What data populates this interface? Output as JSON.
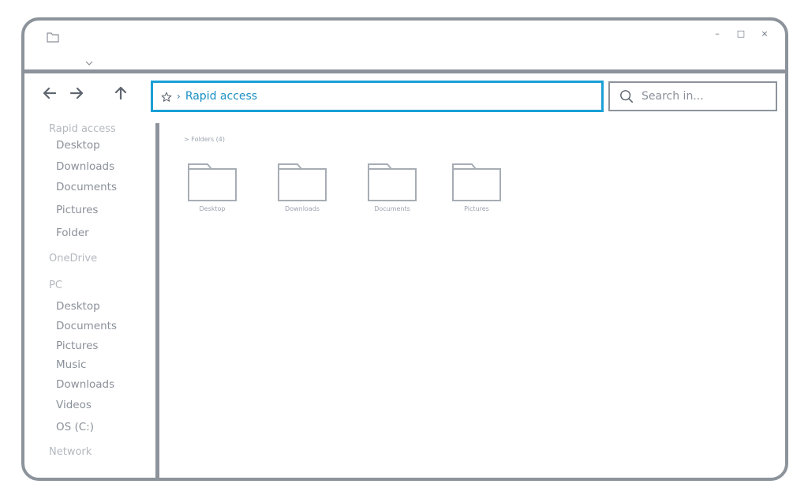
{
  "titlebar": {
    "icon": "folder-icon",
    "chevron_icon": "chevron-down-icon",
    "controls": {
      "minimize": "–",
      "maximize": "□",
      "close": "×"
    }
  },
  "navigation": {
    "back_icon": "arrow-left-icon",
    "forward_icon": "arrow-right-icon",
    "up_icon": "arrow-up-icon"
  },
  "address_bar": {
    "icon": "star-icon",
    "separator": "›",
    "location": "Rapid access"
  },
  "search": {
    "placeholder": "Search in...",
    "icon": "search-icon"
  },
  "sidebar": {
    "sections": [
      {
        "label": "Rapid access",
        "items": [
          "Desktop",
          "Downloads",
          "Documents",
          "Pictures",
          "Folder"
        ]
      },
      {
        "label": "OneDrive",
        "items": []
      },
      {
        "label": "PC",
        "items": [
          "Desktop",
          "Documents",
          "Pictures",
          "Music",
          "Downloads",
          "Videos",
          "OS (C:)"
        ]
      },
      {
        "label": "Network",
        "items": []
      }
    ]
  },
  "content": {
    "group_label": "> Folders (4)",
    "folders": [
      "Desktop",
      "Downloads",
      "Documents",
      "Pictures"
    ]
  },
  "colors": {
    "accent": "#1aa0d6",
    "frame": "#8c939b",
    "text_muted": "#8a9099",
    "text_faint": "#b4b9bf"
  }
}
